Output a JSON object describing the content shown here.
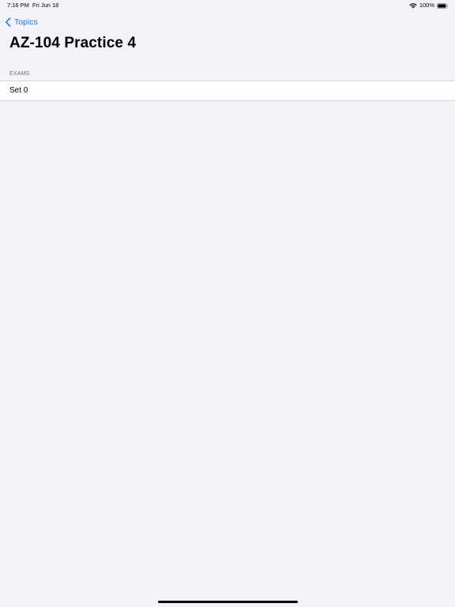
{
  "status_bar": {
    "time": "7:16 PM",
    "date": "Fri Jun 18",
    "battery": "100%"
  },
  "nav": {
    "back_label": "Topics"
  },
  "page": {
    "title": "AZ-104 Practice 4"
  },
  "sections": [
    {
      "header": "EXAMS",
      "items": [
        {
          "label": "Set 0"
        }
      ]
    }
  ],
  "colors": {
    "accent": "#1a7cf5",
    "background": "#f2f2f7",
    "row_background": "#ffffff",
    "section_header": "#6d6d72"
  },
  "icons": {
    "back": "chevron-left-icon",
    "wifi": "wifi-icon",
    "battery": "battery-icon"
  }
}
